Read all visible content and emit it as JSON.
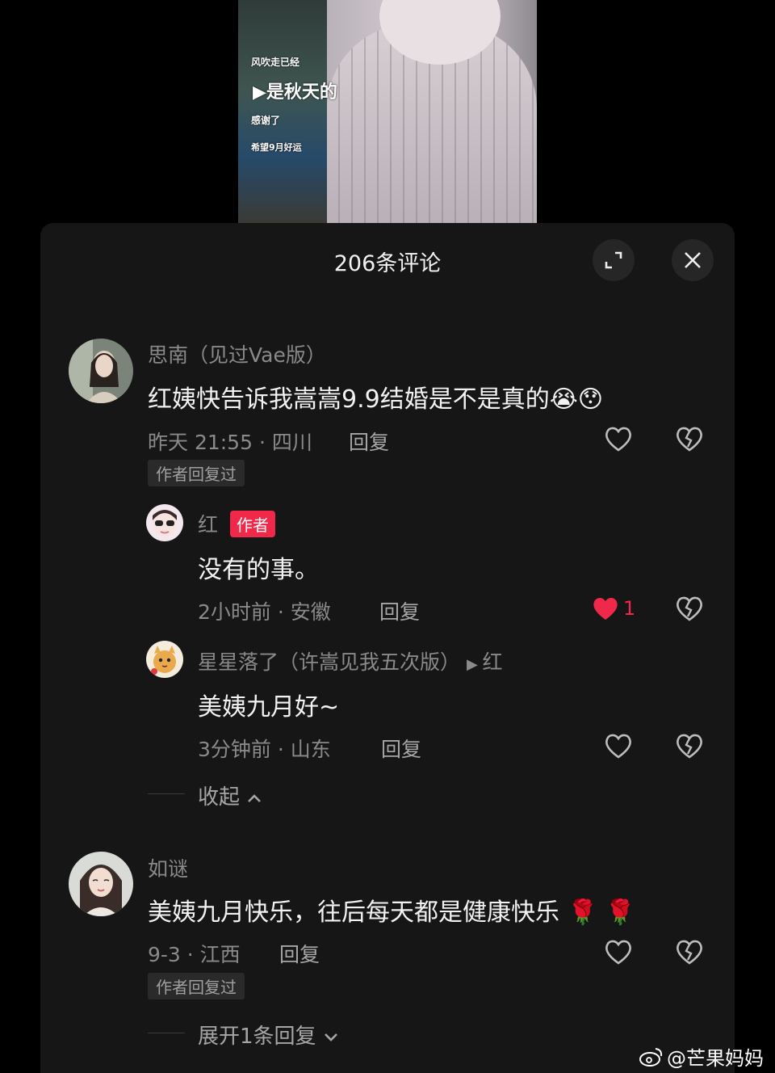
{
  "video": {
    "overlay_line1": "风吹走已经",
    "overlay_line2": "▶是秋天的",
    "overlay_line3": "感谢了",
    "overlay_line4": "希望9月好运"
  },
  "panel": {
    "title": "206条评论"
  },
  "comments": [
    {
      "name": "思南（见过Vae版）",
      "text": "红姨快告诉我嵩嵩9.9结婚是不是真的",
      "emojis": "😭😯",
      "meta": "昨天 21:55 · 四川",
      "reply_label": "回复",
      "tag": "作者回复过"
    },
    {
      "name": "如谜",
      "text": "美姨九月快乐，往后每天都是健康快乐",
      "emojis": "🌹 🌹",
      "meta": "9-3 · 江西",
      "reply_label": "回复",
      "tag": "作者回复过",
      "expand_label": "展开1条回复"
    }
  ],
  "replies": [
    {
      "name": "红",
      "author_tag": "作者",
      "text": "没有的事。",
      "meta": "2小时前 · 安徽",
      "reply_label": "回复",
      "like_count": "1"
    },
    {
      "name": "星星落了（许嵩见我五次版）",
      "reply_to": "红",
      "text": "美姨九月好~",
      "meta": "3分钟前 · 山东",
      "reply_label": "回复"
    }
  ],
  "collapse_label": "收起",
  "watermark": "@芒果妈妈",
  "colors": {
    "panel_bg": "#161616",
    "accent_red": "#f0284a",
    "muted_text": "#8a8a8a"
  }
}
